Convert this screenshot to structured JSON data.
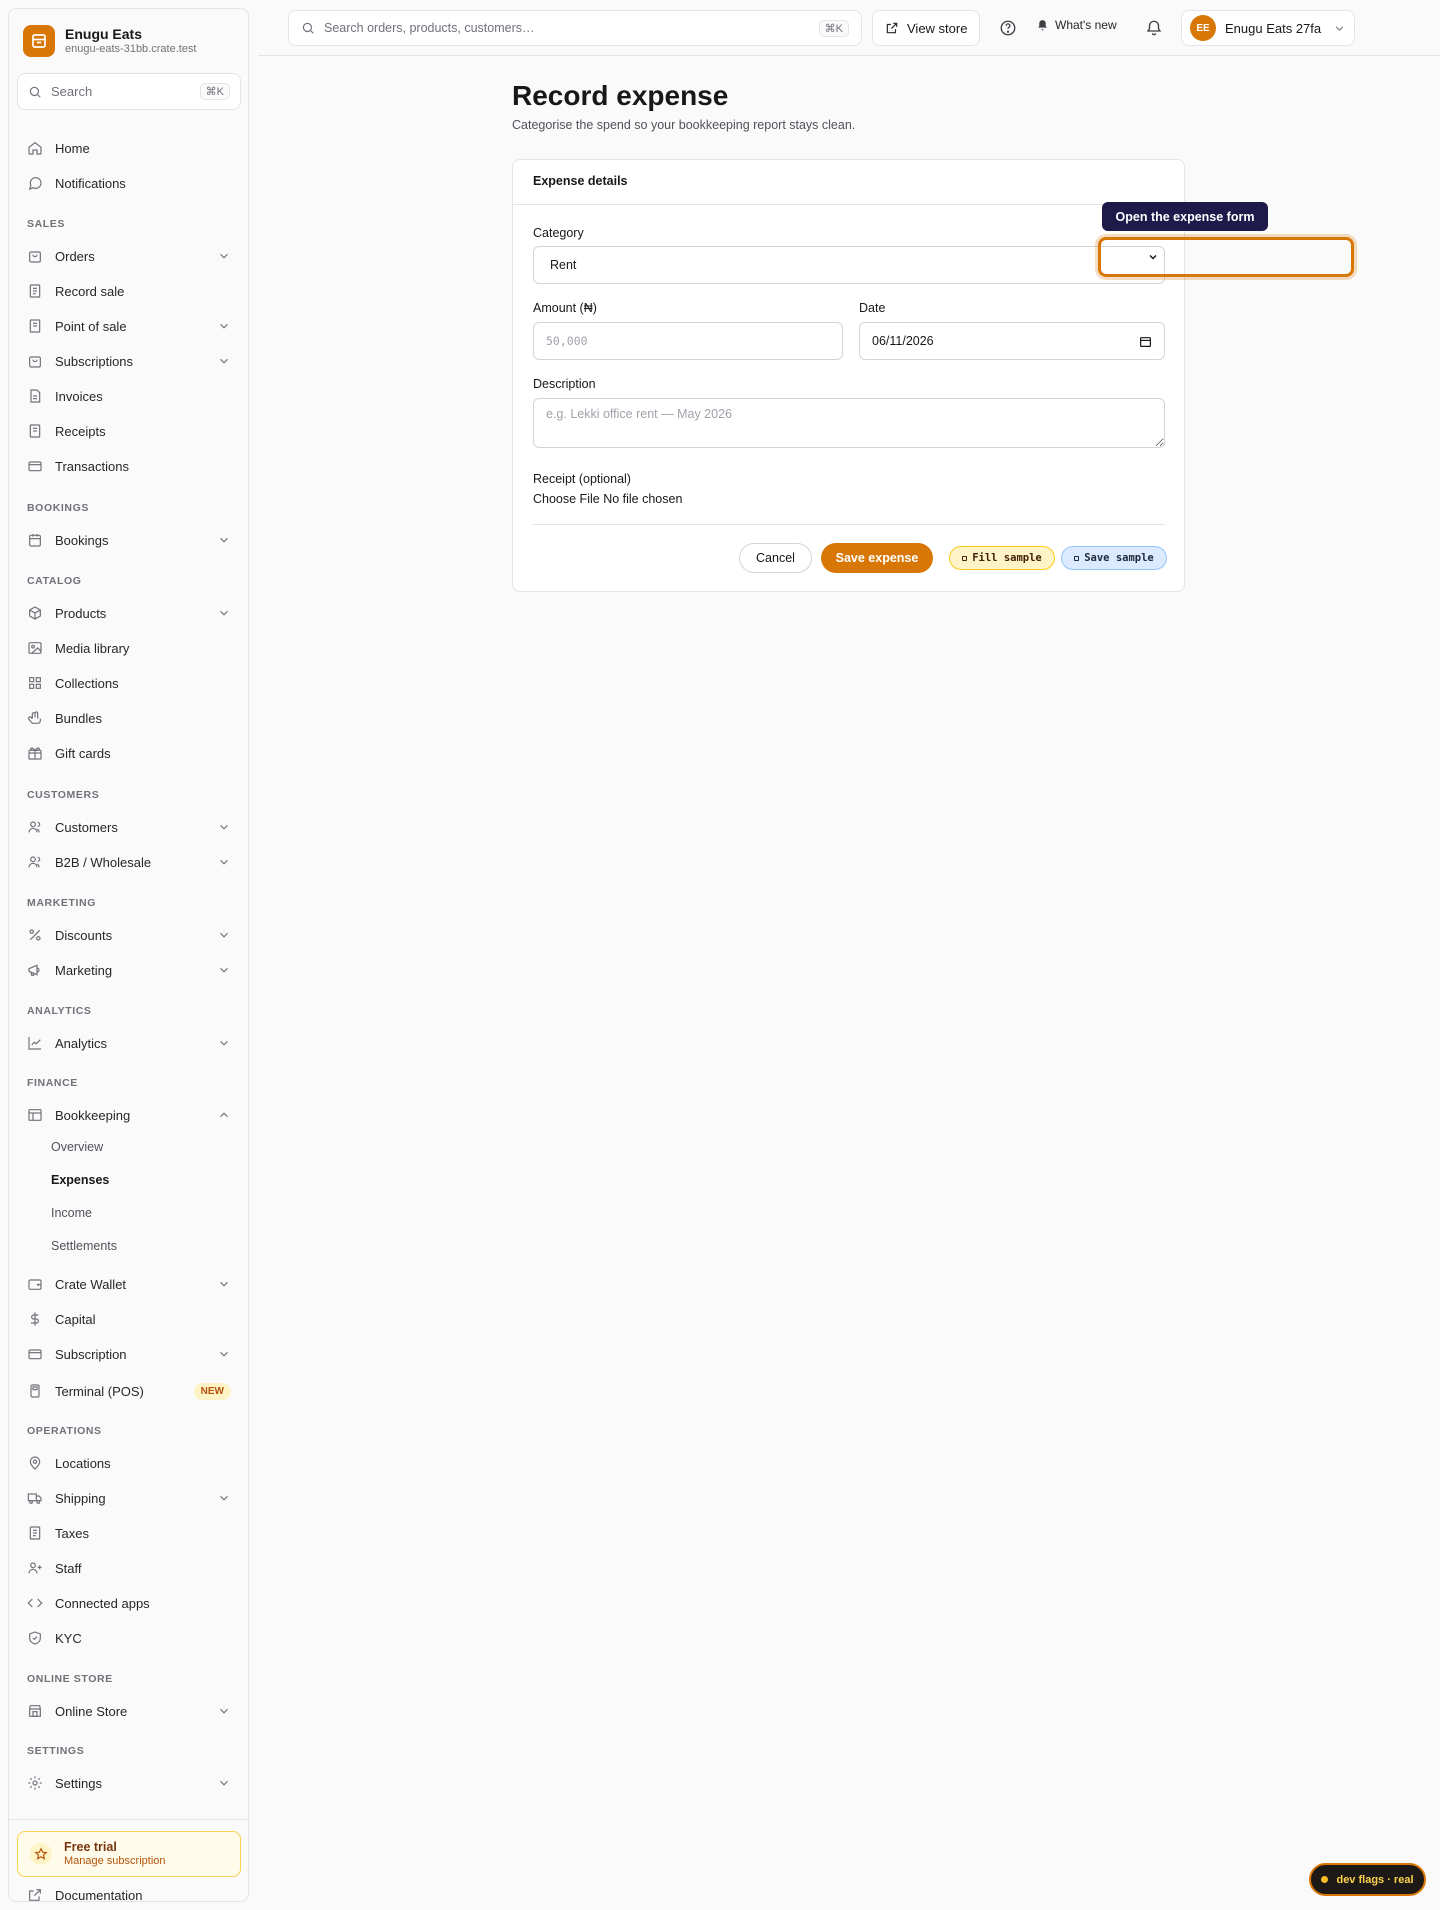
{
  "brand": {
    "name": "Enugu Eats",
    "domain": "enugu-eats-31bb.crate.test"
  },
  "sidebar_search": {
    "label": "Search",
    "shortcut": "⌘K"
  },
  "nav": {
    "home": "Home",
    "notifications": "Notifications",
    "sections": {
      "sales": "SALES",
      "bookings": "BOOKINGS",
      "catalog": "CATALOG",
      "customers": "CUSTOMERS",
      "marketing": "MARKETING",
      "analytics": "ANALYTICS",
      "finance": "FINANCE",
      "operations": "OPERATIONS",
      "online_store": "ONLINE STORE",
      "settings": "SETTINGS"
    },
    "orders": "Orders",
    "record_sale": "Record sale",
    "point_of_sale": "Point of sale",
    "subscriptions": "Subscriptions",
    "invoices": "Invoices",
    "receipts": "Receipts",
    "transactions": "Transactions",
    "bookings": "Bookings",
    "products": "Products",
    "media_library": "Media library",
    "collections": "Collections",
    "bundles": "Bundles",
    "gift_cards": "Gift cards",
    "customers": "Customers",
    "b2b": "B2B / Wholesale",
    "discounts": "Discounts",
    "marketing": "Marketing",
    "analytics": "Analytics",
    "bookkeeping": "Bookkeeping",
    "bookkeeping_sub": {
      "overview": "Overview",
      "expenses": "Expenses",
      "income": "Income",
      "settlements": "Settlements"
    },
    "crate_wallet": "Crate Wallet",
    "capital": "Capital",
    "subscription": "Subscription",
    "terminal": "Terminal (POS)",
    "terminal_badge": "NEW",
    "locations": "Locations",
    "shipping": "Shipping",
    "taxes": "Taxes",
    "staff": "Staff",
    "connected_apps": "Connected apps",
    "kyc": "KYC",
    "online_store": "Online Store",
    "settings": "Settings"
  },
  "trial": {
    "title": "Free trial",
    "subtitle": "Manage subscription"
  },
  "documentation": "Documentation",
  "topbar": {
    "search_placeholder": "Search orders, products, customers…",
    "search_shortcut": "⌘K",
    "view_store": "View store",
    "whats_new": "What's new",
    "user_initials": "EE",
    "user_name": "Enugu Eats 27fa"
  },
  "page": {
    "title": "Record expense",
    "subtitle": "Categorise the spend so your bookkeeping report stays clean."
  },
  "form": {
    "card_title": "Expense details",
    "category_label": "Category",
    "category_value": "Rent",
    "amount_label": "Amount (₦)",
    "amount_placeholder": "50,000",
    "date_label": "Date",
    "date_value": "06/11/2026",
    "description_label": "Description",
    "description_placeholder": "e.g. Lekki office rent — May 2026",
    "receipt_label": "Receipt (optional)",
    "file_button": "Choose File",
    "file_status": "No file chosen",
    "cancel": "Cancel",
    "save": "Save expense",
    "fill_sample": "Fill sample",
    "save_sample": "Save sample"
  },
  "tooltip": "Open the expense form",
  "dev_flags": "dev flags · real",
  "colors": {
    "accent": "#d97706",
    "tooltip_bg": "#1e1b4b"
  }
}
